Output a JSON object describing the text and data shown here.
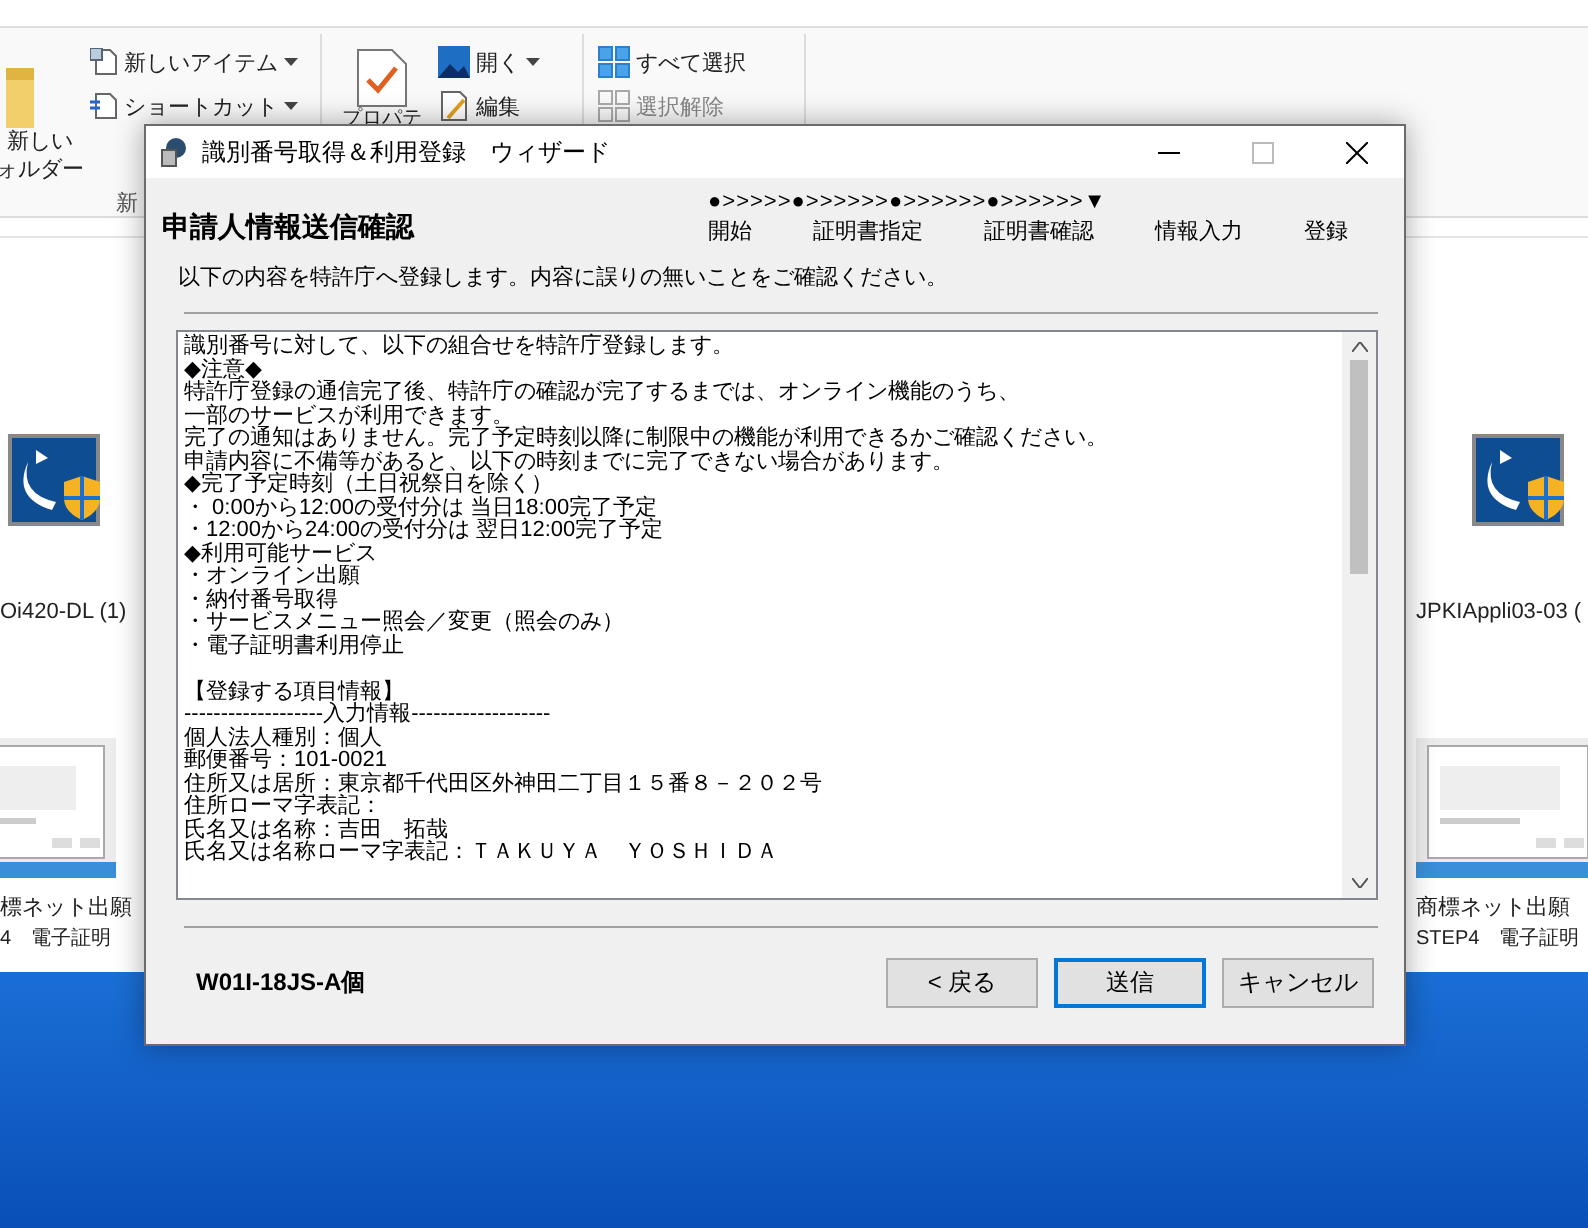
{
  "ribbon": {
    "new_folder": [
      "新しい",
      "ォルダー"
    ],
    "items": [
      {
        "label": "新しいアイテム",
        "dropdown": true
      },
      {
        "label": "ショートカット",
        "dropdown": true
      }
    ],
    "group_label": "新",
    "properties_label": "プロパテ",
    "open_items": [
      {
        "label": "開く",
        "dropdown": true
      },
      {
        "label": "編集",
        "dropdown": false
      }
    ],
    "select_items": [
      {
        "label": "すべて選択",
        "disabled": false
      },
      {
        "label": "選択解除",
        "disabled": true
      }
    ]
  },
  "files_left": [
    {
      "name": "Oi420-DL (1)",
      "kind": "app"
    },
    {
      "name": "標ネット出願",
      "sub": "4　電子証明",
      "kind": "screenshot"
    }
  ],
  "files_right": [
    {
      "name": "JPKIAppli03-03 (",
      "kind": "app"
    },
    {
      "name": "商標ネット出願",
      "sub": "STEP4　電子証明",
      "kind": "screenshot"
    }
  ],
  "dialog": {
    "title": "識別番号取得＆利用登録　ウィザード",
    "heading": "申請人情報送信確認",
    "progress": "●>>>>>●>>>>>>●>>>>>>●>>>>>>▼",
    "steps": [
      "開始",
      "証明書指定",
      "証明書確認",
      "情報入力",
      "登録"
    ],
    "instruction": "以下の内容を特許庁へ登録します。内容に誤りの無いことをご確認ください。",
    "content_lines": [
      "識別番号に対して、以下の組合せを特許庁登録します。",
      "◆注意◆",
      "特許庁登録の通信完了後、特許庁の確認が完了するまでは、オンライン機能のうち、",
      "一部のサービスが利用できます。",
      "完了の通知はありません。完了予定時刻以降に制限中の機能が利用できるかご確認ください。",
      "申請内容に不備等があると、以下の時刻までに完了できない場合があります。",
      "◆完了予定時刻（土日祝祭日を除く）",
      "・ 0:00から12:00の受付分は 当日18:00完了予定",
      "・12:00から24:00の受付分は 翌日12:00完了予定",
      "◆利用可能サービス",
      "・オンライン出願",
      "・納付番号取得",
      "・サービスメニュー照会／変更（照会のみ）",
      "・電子証明書利用停止"
    ],
    "registration_lines": [
      "【登録する項目情報】",
      "-------------------入力情報-------------------",
      "個人法人種別：個人",
      "郵便番号：101-0021",
      "住所又は居所：東京都千代田区外神田二丁目１５番８－２０２号",
      "住所ローマ字表記：",
      "氏名又は名称：吉田　拓哉",
      "氏名又は名称ローマ字表記：ＴＡＫＵＹＡ　ＹＯＳＨＩＤＡ"
    ],
    "code": "W01I-18JS-A個",
    "buttons": [
      {
        "label": "< 戻る",
        "default": false
      },
      {
        "label": "送信",
        "default": true
      },
      {
        "label": "キャンセル",
        "default": false
      }
    ]
  }
}
